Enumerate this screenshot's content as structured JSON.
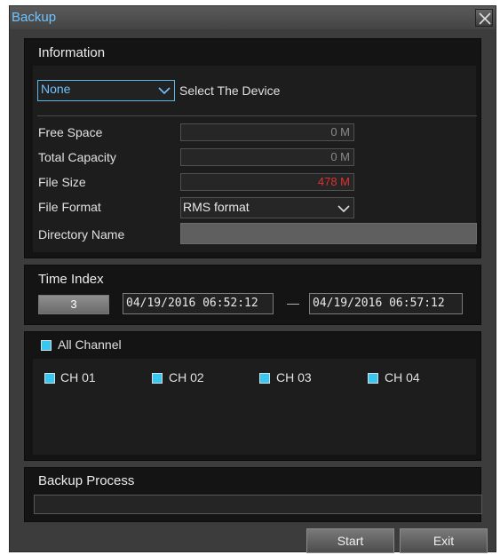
{
  "window": {
    "title": "Backup"
  },
  "information": {
    "header": "Information",
    "device_select": "None",
    "device_label": "Select The Device",
    "free_space_label": "Free Space",
    "free_space_value": "0 M",
    "total_capacity_label": "Total Capacity",
    "total_capacity_value": "0 M",
    "file_size_label": "File Size",
    "file_size_value": "478 M",
    "file_format_label": "File Format",
    "file_format_value": "RMS format",
    "directory_name_label": "Directory Name",
    "directory_name_value": ""
  },
  "time_index": {
    "header": "Time Index",
    "button": "3",
    "start": "04/19/2016  06:52:12",
    "separator": "—",
    "end": "04/19/2016  06:57:12"
  },
  "channels": {
    "all_label": "All Channel",
    "items": [
      "CH 01",
      "CH 02",
      "CH 03",
      "CH 04"
    ]
  },
  "backup_process": {
    "header": "Backup Process"
  },
  "buttons": {
    "start": "Start",
    "exit": "Exit"
  },
  "colors": {
    "accent": "#36c8f2",
    "title": "#6fc3ff",
    "file_size": "#e03030"
  }
}
